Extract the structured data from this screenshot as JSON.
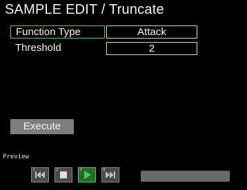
{
  "header": {
    "title": "SAMPLE EDIT / Truncate"
  },
  "params": [
    {
      "label": "Function Type",
      "value": "Attack",
      "selected": true
    },
    {
      "label": "Threshold",
      "value": "2",
      "selected": false
    }
  ],
  "execute": {
    "label": "Execute"
  },
  "preview": {
    "label": "Preview",
    "buttons": [
      {
        "name": "rewind-icon",
        "number": "1",
        "active": false
      },
      {
        "name": "stop-icon",
        "number": "2",
        "active": false
      },
      {
        "name": "play-icon",
        "number": "3",
        "active": true
      },
      {
        "name": "fast-forward-icon",
        "number": "4",
        "active": false
      }
    ],
    "progress": 0
  },
  "colors": {
    "background": "#000000",
    "selection": "#3fd07a",
    "active_button": "#246b2c",
    "active_icon": "#3ecf56",
    "button": "#7d7d7d"
  }
}
